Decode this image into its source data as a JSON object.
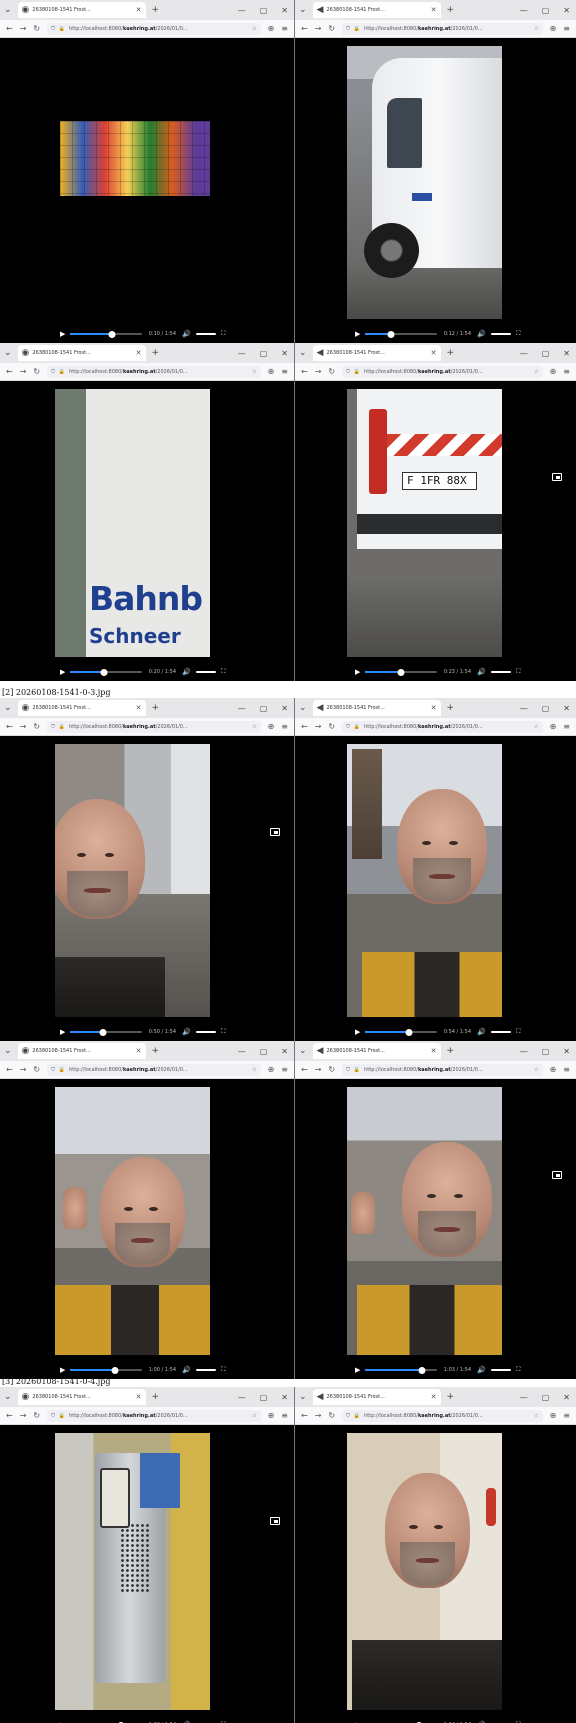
{
  "browser": {
    "tab_title": "26380108-1541 Frost...",
    "url_prefix": "http://localhost:8080/",
    "url_domain": "kaehring.at",
    "url_suffix": "/2026/01/0...",
    "win_minimize": "—",
    "win_maximize": "▢",
    "win_close": "✕"
  },
  "sheets": [
    {
      "label": ""
    },
    {
      "label": "[2] 20260108-1541-0-3.jpg"
    },
    {
      "label": "[3] 20260108-1541-0-4.jpg"
    }
  ],
  "panels": [
    {
      "time": "0:10 / 1:54",
      "progress": 0.58,
      "scene": "collage"
    },
    {
      "time": "0:12 / 1:54",
      "progress": 0.35,
      "scene": "van"
    },
    {
      "time": "0:20 / 1:54",
      "progress": 0.46,
      "scene": "bahn",
      "text1": "Bahnb",
      "text2": "Schneer"
    },
    {
      "time": "0:23 / 1:54",
      "progress": 0.5,
      "scene": "van-rear",
      "plate": "F 1FR 88X"
    },
    {
      "time": "0:50 / 1:54",
      "progress": 0.45,
      "scene": "man-street"
    },
    {
      "time": "0:54 / 1:54",
      "progress": 0.6,
      "scene": "man-square"
    },
    {
      "time": "1:00 / 1:54",
      "progress": 0.62,
      "scene": "man-point"
    },
    {
      "time": "1:03 / 1:54",
      "progress": 0.78,
      "scene": "man-fist"
    },
    {
      "time": "1:30 / 1:54",
      "progress": 0.7,
      "scene": "elevator"
    },
    {
      "time": "1:34 / 1:54",
      "progress": 0.74,
      "scene": "man-hall"
    }
  ],
  "icons": {
    "play": "▶",
    "volume": "🔊",
    "fullscreen": "⛶",
    "back": "←",
    "forward": "→",
    "reload": "↻",
    "shield": "⛉",
    "lock": "🔒",
    "star": "☆",
    "menu": "≡",
    "new_tab": "+",
    "tab_list": "⌄",
    "extension": "⊕"
  },
  "colors": {
    "accent": "#2a8cff",
    "tab_bar": "#e7e7ea",
    "video_bg": "#000000"
  }
}
